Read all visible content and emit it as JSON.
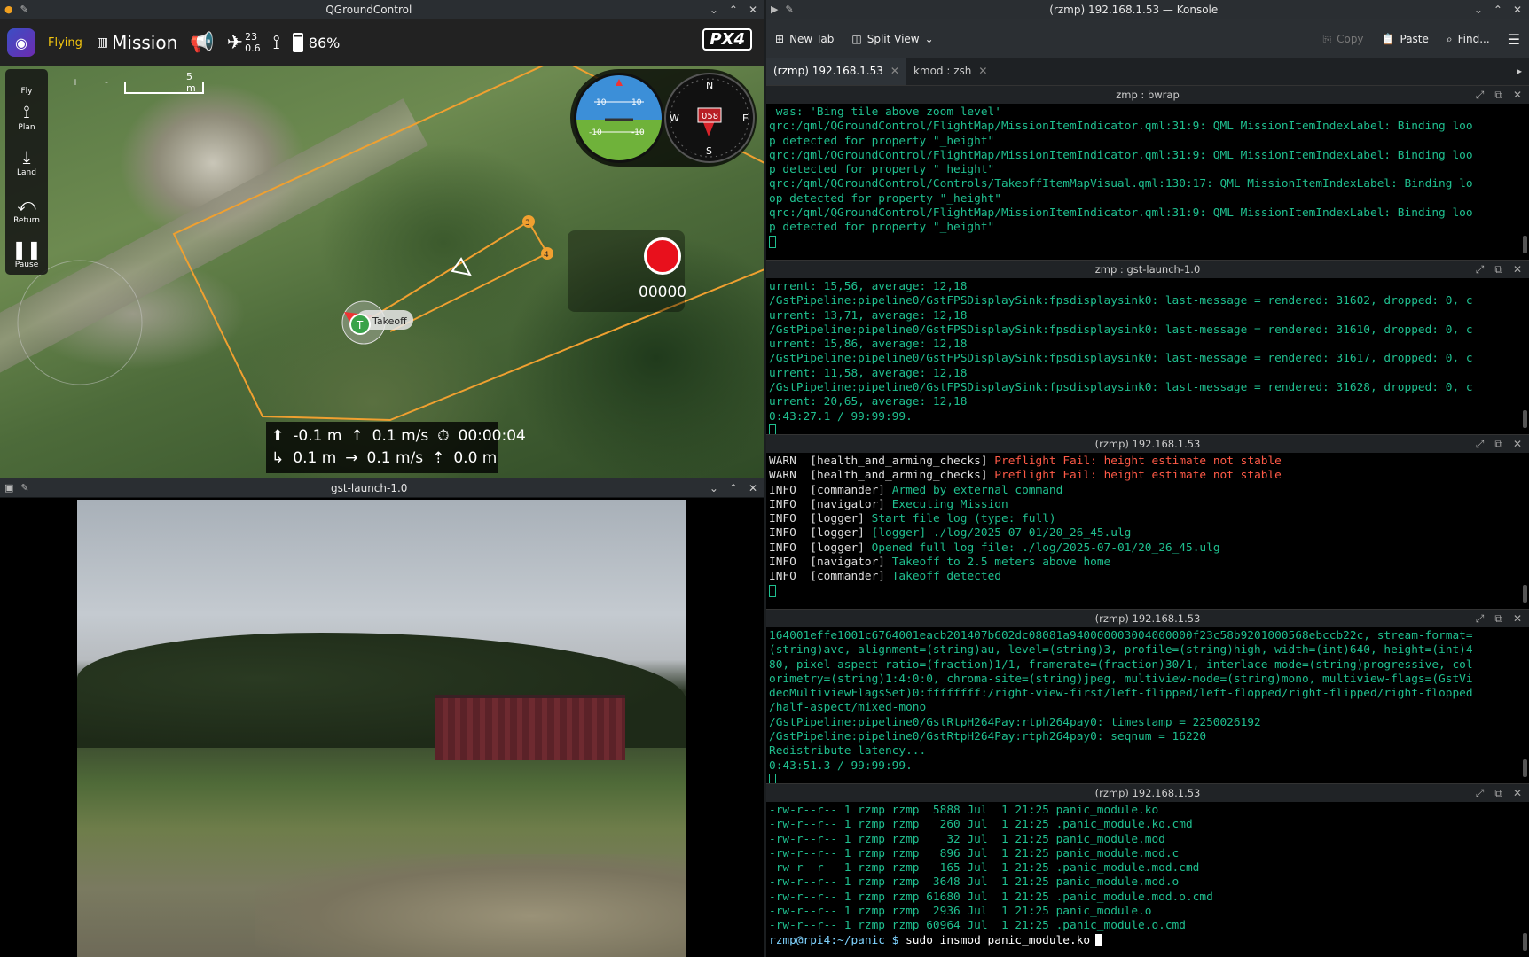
{
  "qgc": {
    "window_title": "QGroundControl",
    "flight_mode": "Flying",
    "mission_label": "Mission",
    "gps_count": "23",
    "gps_hdop": "0.6",
    "battery": "86%",
    "px4_logo": "PX4",
    "tools": [
      {
        "label": "Fly",
        "icon": "fly-icon"
      },
      {
        "label": "Plan",
        "icon": "plan-icon"
      },
      {
        "label": "Land",
        "icon": "land-icon"
      },
      {
        "label": "Return",
        "icon": "return-icon"
      },
      {
        "label": "Pause",
        "icon": "pause-icon"
      }
    ],
    "zoom_in": "+",
    "zoom_out": "-",
    "scale_label": "5 m",
    "waypoint_3": "3",
    "waypoint_4": "4",
    "takeoff_label": "Takeoff",
    "takeoff_marker": "T",
    "attitude_ticks": [
      "10",
      "10",
      "-10",
      "-10"
    ],
    "compass_letters": {
      "n": "N",
      "s": "S",
      "e": "E",
      "w": "W"
    },
    "heading": "058",
    "recording_counter": "00000",
    "telemetry": {
      "altitude_rel": "-0.1 m",
      "vertical_speed": "0.1 m/s",
      "flight_time": "00:00:04",
      "distance": "0.1 m",
      "ground_speed": "0.1 m/s",
      "altitude_amsl": "0.0 m"
    }
  },
  "gst": {
    "window_title": "gst-launch-1.0"
  },
  "konsole": {
    "window_title": "(rzmp) 192.168.1.53 — Konsole",
    "toolbar": {
      "new_tab": "New Tab",
      "split_view": "Split View",
      "copy": "Copy",
      "paste": "Paste",
      "find": "Find..."
    },
    "tabs": [
      "(rzmp) 192.168.1.53",
      "kmod : zsh"
    ],
    "panes": [
      {
        "title": "zmp : bwrap",
        "lines": [
          " was: 'Bing tile above zoom level'",
          "qrc:/qml/QGroundControl/FlightMap/MissionItemIndicator.qml:31:9: QML MissionItemIndexLabel: Binding loo",
          "p detected for property \"_height\"",
          "qrc:/qml/QGroundControl/FlightMap/MissionItemIndicator.qml:31:9: QML MissionItemIndexLabel: Binding loo",
          "p detected for property \"_height\"",
          "qrc:/qml/QGroundControl/Controls/TakeoffItemMapVisual.qml:130:17: QML MissionItemIndexLabel: Binding lo",
          "op detected for property \"_height\"",
          "qrc:/qml/QGroundControl/FlightMap/MissionItemIndicator.qml:31:9: QML MissionItemIndexLabel: Binding loo",
          "p detected for property \"_height\""
        ]
      },
      {
        "title": "zmp : gst-launch-1.0",
        "lines": [
          "urrent: 15,56, average: 12,18",
          "/GstPipeline:pipeline0/GstFPSDisplaySink:fpsdisplaysink0: last-message = rendered: 31602, dropped: 0, c",
          "urrent: 13,71, average: 12,18",
          "/GstPipeline:pipeline0/GstFPSDisplaySink:fpsdisplaysink0: last-message = rendered: 31610, dropped: 0, c",
          "urrent: 15,86, average: 12,18",
          "/GstPipeline:pipeline0/GstFPSDisplaySink:fpsdisplaysink0: last-message = rendered: 31617, dropped: 0, c",
          "urrent: 11,58, average: 12,18",
          "/GstPipeline:pipeline0/GstFPSDisplaySink:fpsdisplaysink0: last-message = rendered: 31628, dropped: 0, c",
          "urrent: 20,65, average: 12,18",
          "0:43:27.1 / 99:99:99."
        ]
      },
      {
        "title": "(rzmp) 192.168.1.53",
        "log": [
          {
            "level": "WARN",
            "src": "[health_and_arming_checks]",
            "msg": "Preflight Fail: height estimate not stable"
          },
          {
            "level": "WARN",
            "src": "[health_and_arming_checks]",
            "msg": "Preflight Fail: height estimate not stable"
          },
          {
            "level": "INFO",
            "src": "[commander]",
            "msg": "Armed by external command"
          },
          {
            "level": "INFO",
            "src": "[navigator]",
            "msg": "Executing Mission"
          },
          {
            "level": "INFO",
            "src": "[logger]",
            "msg": "Start file log (type: full)"
          },
          {
            "level": "INFO",
            "src": "[logger]",
            "msg": "[logger] ./log/2025-07-01/20_26_45.ulg"
          },
          {
            "level": "INFO",
            "src": "[logger]",
            "msg": "Opened full log file: ./log/2025-07-01/20_26_45.ulg"
          },
          {
            "level": "INFO",
            "src": "[navigator]",
            "msg": "Takeoff to 2.5 meters above home"
          },
          {
            "level": "INFO",
            "src": "[commander]",
            "msg": "Takeoff detected"
          }
        ]
      },
      {
        "title": "(rzmp) 192.168.1.53",
        "lines": [
          "164001effe1001c6764001eacb201407b602dc08081a940000003004000000f23c58b9201000568ebccb22c, stream-format=",
          "(string)avc, alignment=(string)au, level=(string)3, profile=(string)high, width=(int)640, height=(int)4",
          "80, pixel-aspect-ratio=(fraction)1/1, framerate=(fraction)30/1, interlace-mode=(string)progressive, col",
          "orimetry=(string)1:4:0:0, chroma-site=(string)jpeg, multiview-mode=(string)mono, multiview-flags=(GstVi",
          "deoMultiviewFlagsSet)0:ffffffff:/right-view-first/left-flipped/left-flopped/right-flipped/right-flopped",
          "/half-aspect/mixed-mono",
          "/GstPipeline:pipeline0/GstRtpH264Pay:rtph264pay0: timestamp = 2250026192",
          "/GstPipeline:pipeline0/GstRtpH264Pay:rtph264pay0: seqnum = 16220",
          "Redistribute latency...",
          "0:43:51.3 / 99:99:99."
        ]
      },
      {
        "title": "(rzmp) 192.168.1.53",
        "lines": [
          "-rw-r--r-- 1 rzmp rzmp  5888 Jul  1 21:25 panic_module.ko",
          "-rw-r--r-- 1 rzmp rzmp   260 Jul  1 21:25 .panic_module.ko.cmd",
          "-rw-r--r-- 1 rzmp rzmp    32 Jul  1 21:25 panic_module.mod",
          "-rw-r--r-- 1 rzmp rzmp   896 Jul  1 21:25 panic_module.mod.c",
          "-rw-r--r-- 1 rzmp rzmp   165 Jul  1 21:25 .panic_module.mod.cmd",
          "-rw-r--r-- 1 rzmp rzmp  3648 Jul  1 21:25 panic_module.mod.o",
          "-rw-r--r-- 1 rzmp rzmp 61680 Jul  1 21:25 .panic_module.mod.o.cmd",
          "-rw-r--r-- 1 rzmp rzmp  2936 Jul  1 21:25 panic_module.o",
          "-rw-r--r-- 1 rzmp rzmp 60964 Jul  1 21:25 .panic_module.o.cmd"
        ],
        "prompt": "rzmp@rpi4:~/panic $ ",
        "command": "sudo insmod panic_module.ko"
      }
    ]
  }
}
